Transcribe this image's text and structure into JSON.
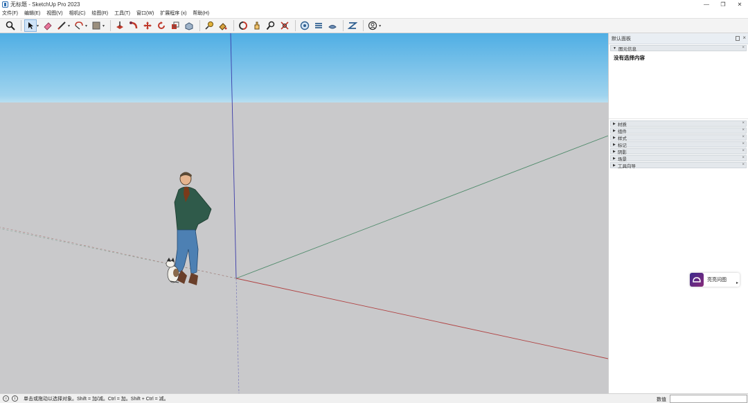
{
  "window": {
    "title": "无标题 - SketchUp Pro 2023",
    "minimize": "—",
    "maximize": "❐",
    "close": "✕"
  },
  "menu": [
    "文件(F)",
    "编辑(E)",
    "视图(V)",
    "相机(C)",
    "绘图(R)",
    "工具(T)",
    "窗口(W)",
    "扩展程序 (x)",
    "帮助(H)"
  ],
  "toolbar": {
    "icons": [
      "search-icon",
      "select-icon",
      "eraser-icon",
      "pencil-icon",
      "shapes-icon",
      "material-icon",
      "pushpull-icon",
      "followme-icon",
      "move-icon",
      "rotate-icon",
      "scale-icon",
      "offset-icon",
      "tape-icon",
      "paint-icon",
      "orbit-icon",
      "pan-icon",
      "zoom-icon",
      "zoom-extents-icon",
      "warehouse-icon",
      "extension-warehouse-icon",
      "layout-icon",
      "send-icon",
      "account-icon"
    ],
    "carets": "▾"
  },
  "tray": {
    "title": "默认面板",
    "close": "×",
    "entity_info": {
      "label": "图元信息",
      "content": "没有选择内容"
    },
    "panels": [
      "材质",
      "组件",
      "样式",
      "标记",
      "阴影",
      "场景",
      "工具向导"
    ],
    "panel_close": "×",
    "tri_open": "▼",
    "tri_closed": "▶"
  },
  "widget": {
    "label": "亮亮问图",
    "arrow": "▸"
  },
  "status": {
    "hint": "单击或拖动以选择对象。Shift = 加/减。Ctrl = 加。Shift + Ctrl = 减。",
    "measurements_label": "数值",
    "icon1": "○",
    "icon2": "i"
  },
  "colors": {
    "sky_top": "#4faee4",
    "ground": "#c9c9cb",
    "axis_red": "#b04040",
    "axis_green": "#4e8a6a",
    "axis_blue": "#3a3aa8"
  }
}
